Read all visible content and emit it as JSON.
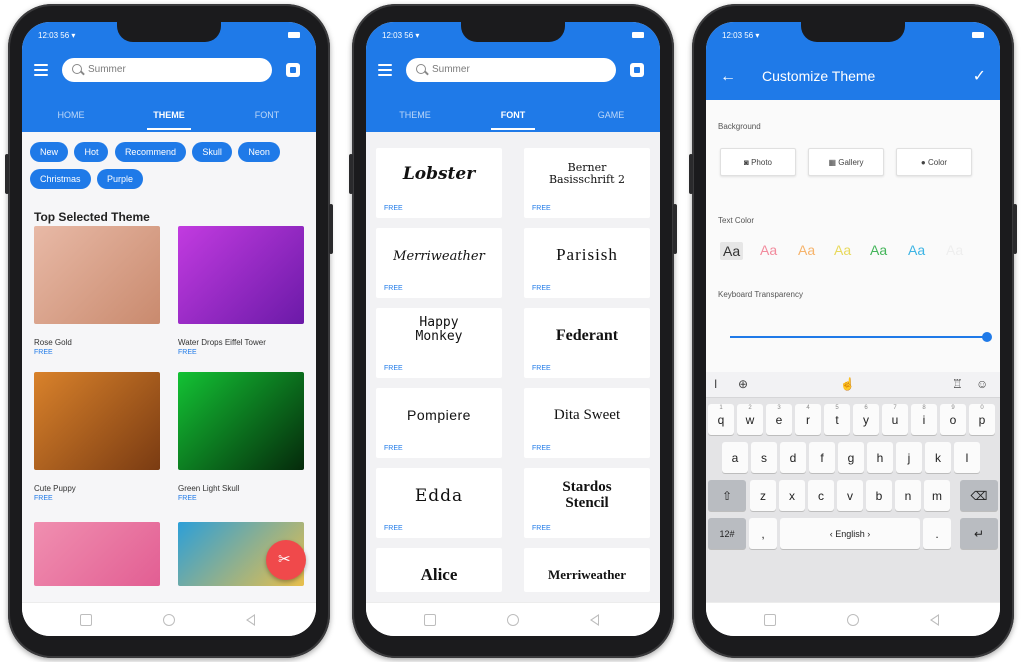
{
  "phones": {
    "status_time": "12:03 56 ▾",
    "nav_icons": [
      "square-icon",
      "circle-icon",
      "triangle-icon"
    ]
  },
  "phone1": {
    "search_placeholder": "Summer",
    "tabs": [
      "HOME",
      "THEME",
      "FONT"
    ],
    "active_tab": "THEME",
    "chips": [
      "New",
      "Hot",
      "Recommend",
      "Skull",
      "Neon",
      "Christmas",
      "Purple"
    ],
    "section_title": "Top Selected Theme",
    "themes": [
      {
        "name": "Rose Gold",
        "price": "FREE",
        "colors": [
          "#e8b9a6",
          "#c98a6e"
        ]
      },
      {
        "name": "Water Drops Eiffel Tower",
        "price": "FREE",
        "colors": [
          "#c23be0",
          "#6b1aa8"
        ]
      },
      {
        "name": "Cute Puppy",
        "price": "FREE",
        "colors": [
          "#d9822b",
          "#7a3b12"
        ]
      },
      {
        "name": "Green Light Skull",
        "price": "FREE",
        "colors": [
          "#13c234",
          "#052a0b"
        ]
      },
      {
        "name": "",
        "price": "",
        "colors": [
          "#f08fb0",
          "#e25e93"
        ]
      },
      {
        "name": "",
        "price": "",
        "colors": [
          "#2c9fd8",
          "#e9bf4b"
        ]
      }
    ]
  },
  "phone2": {
    "search_placeholder": "Summer",
    "tabs": [
      "THEME",
      "FONT",
      "GAME"
    ],
    "active_tab": "FONT",
    "fonts": [
      {
        "sample": "Lobster",
        "price": "FREE"
      },
      {
        "sample": "Berner Basisschrift 2",
        "price": "FREE"
      },
      {
        "sample": "Merriweather",
        "price": "FREE"
      },
      {
        "sample": "Parisish",
        "price": "FREE"
      },
      {
        "sample": "Happy Monkey",
        "price": "FREE"
      },
      {
        "sample": "Federant",
        "price": "FREE"
      },
      {
        "sample": "Pompiere",
        "price": "FREE"
      },
      {
        "sample": "Dita Sweet",
        "price": "FREE"
      },
      {
        "sample": "Edda",
        "price": "FREE"
      },
      {
        "sample": "Stardos Stencil",
        "price": "FREE"
      },
      {
        "sample": "Alice",
        "price": ""
      },
      {
        "sample": "Merriweather",
        "price": ""
      }
    ]
  },
  "phone3": {
    "title": "Customize Theme",
    "background_label": "Background",
    "bg_buttons": [
      "Photo",
      "Gallery",
      "Color"
    ],
    "text_color_label": "Text Color",
    "swatches": [
      {
        "text": "Aa",
        "color": "#333333"
      },
      {
        "text": "Aa",
        "color": "#f28b9d"
      },
      {
        "text": "Aa",
        "color": "#f6b36b"
      },
      {
        "text": "Aa",
        "color": "#e8d95c"
      },
      {
        "text": "Aa",
        "color": "#44b55a"
      },
      {
        "text": "Aa",
        "color": "#3db4e4"
      },
      {
        "text": "Aa",
        "color": "#eeeeee"
      }
    ],
    "transparency_label": "Keyboard Transparency",
    "transparency_value": 1.0,
    "keyboard": {
      "row1": [
        "q",
        "w",
        "e",
        "r",
        "t",
        "y",
        "u",
        "i",
        "o",
        "p"
      ],
      "row1_hints": [
        "1",
        "2",
        "3",
        "4",
        "5",
        "6",
        "7",
        "8",
        "9",
        "0"
      ],
      "row2": [
        "a",
        "s",
        "d",
        "f",
        "g",
        "h",
        "j",
        "k",
        "l"
      ],
      "row3": [
        "z",
        "x",
        "c",
        "v",
        "b",
        "n",
        "m"
      ],
      "num_key": "12#",
      "space_label": "‹ English ›",
      "comma": ",",
      "period": "."
    }
  },
  "colors": {
    "primary": "#1f7ae8",
    "fab": "#f0494b"
  }
}
